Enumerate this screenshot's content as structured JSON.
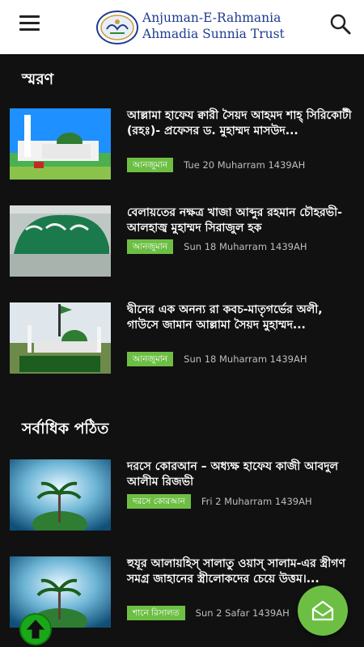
{
  "header": {
    "logo_line1": "Anjuman-E-Rahmania",
    "logo_line2": "Ahmadia Sunnia Trust"
  },
  "sections": [
    {
      "title": "স্মরণ",
      "articles": [
        {
          "title": " আল্লামা  হাফেয ক্বারী সৈয়দ আহমদ শাহ্ সিরিকোটী (রহঃ)- প্রফেসর ড. মুহাম্মদ মাসউদ...",
          "category": "আনজুমান",
          "date": "Tue 20 Muharram 1439AH",
          "thumb": "mosque-sky-illustration"
        },
        {
          "title": "বেলায়তের নক্ষত্র খাজা আব্দুর রহমান চৌহরভী-আলহাজ্ব মুহাম্মদ সিরাজুল হক",
          "category": "আনজুমান",
          "date": "Sun 18 Muharram 1439AH",
          "thumb": "calligraphy-shrine-sign"
        },
        {
          "title": "দ্বীনের এক অনন্য রা কবচ-মাতৃগর্ভের অলী, গাউসে জামান আল্লামা সৈয়দ মুহাম্মদ...",
          "category": "আনজুমান",
          "date": "Sun 18 Muharram 1439AH",
          "thumb": "green-dome-mosque"
        }
      ]
    },
    {
      "title": "সর্বাধিক পঠিত",
      "articles": [
        {
          "title": "দরসে কোরআন – অধ্যক্ষ হাফেয কাজী আবদুল আলীম রিজভী",
          "category": "দরসে কোরআন",
          "date": "Fri 2 Muharram 1439AH",
          "thumb": "palm-dome-blue"
        },
        {
          "title": "হুযূর আলায়হিস্ সালাতু ওয়াস্ সালাম-এর স্ত্রীগণ সমগ্র জাহানের স্ত্রীলোকদের চেয়ে উত্তম।...",
          "category": "শানে রিসালত",
          "date": "Sun 2 Safar 1439AH",
          "thumb": "palm-dome-blue"
        }
      ]
    }
  ],
  "colors": {
    "background": "#111111",
    "accent_green": "#6dbf44",
    "logo_blue": "#1f3c8f",
    "date_gray": "#bdbdbd"
  },
  "icons": {
    "menu": "hamburger-menu-icon",
    "search": "search-icon",
    "fab": "envelope-icon",
    "scroll_top": "arrow-up-icon"
  }
}
